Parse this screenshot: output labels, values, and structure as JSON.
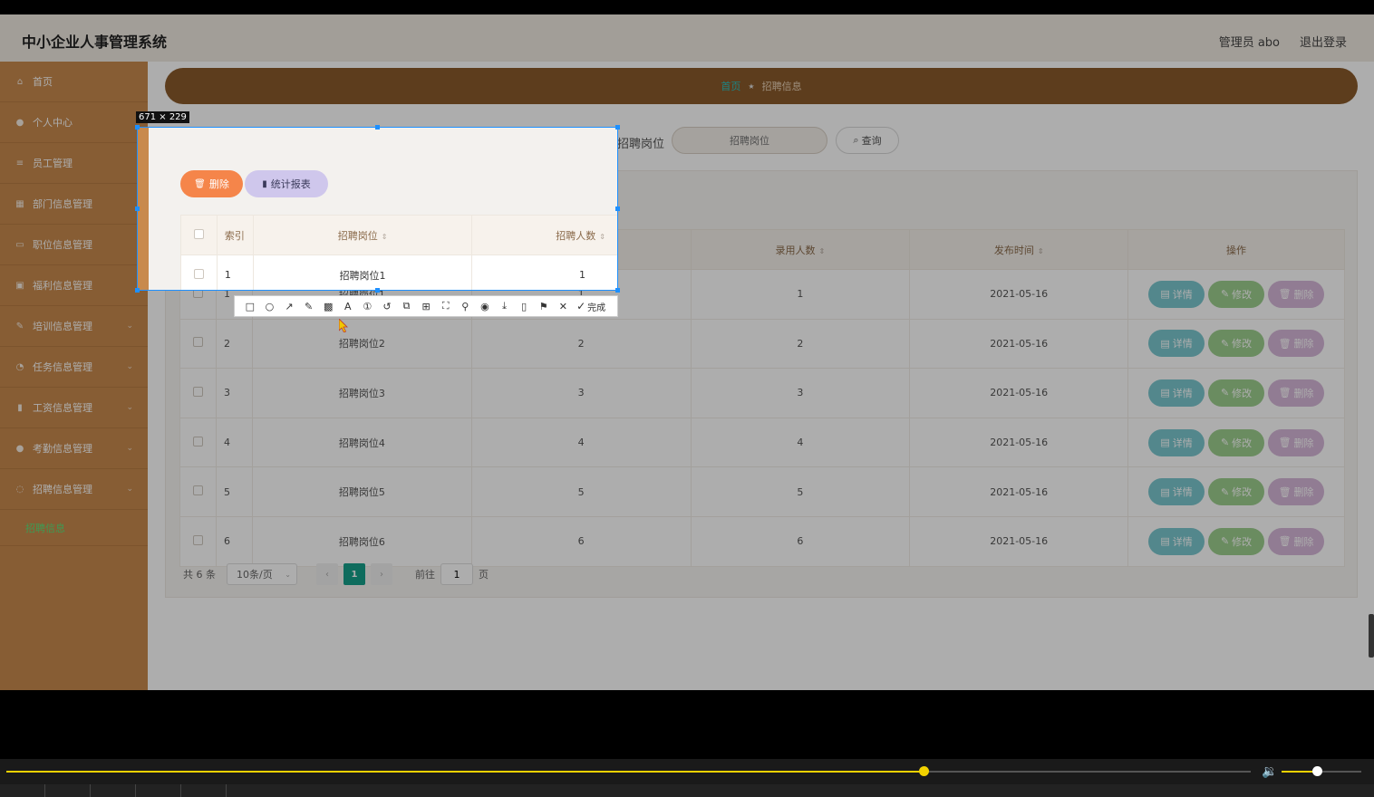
{
  "header": {
    "title": "中小企业人事管理系统",
    "admin": "管理员 abo",
    "logout": "退出登录"
  },
  "sidebar": {
    "items": [
      {
        "label": "首页",
        "icon": "home-icon",
        "glyph": "⌂"
      },
      {
        "label": "个人中心",
        "icon": "user-icon",
        "glyph": "●"
      },
      {
        "label": "员工管理",
        "icon": "list-icon",
        "glyph": "≡"
      },
      {
        "label": "部门信息管理",
        "icon": "building-icon",
        "glyph": "▦"
      },
      {
        "label": "职位信息管理",
        "icon": "briefcase-icon",
        "glyph": "▭"
      },
      {
        "label": "福利信息管理",
        "icon": "gift-icon",
        "glyph": "▣"
      },
      {
        "label": "培训信息管理",
        "icon": "edit-icon",
        "glyph": "✎"
      },
      {
        "label": "任务信息管理",
        "icon": "task-icon",
        "glyph": "◔"
      },
      {
        "label": "工资信息管理",
        "icon": "chart-icon",
        "glyph": "▮"
      },
      {
        "label": "考勤信息管理",
        "icon": "people-icon",
        "glyph": "●"
      },
      {
        "label": "招聘信息管理",
        "icon": "recruit-icon",
        "glyph": "◌"
      }
    ],
    "sub_item": "招聘信息"
  },
  "breadcrumb": {
    "home": "首页",
    "current": "招聘信息"
  },
  "search": {
    "label": "招聘岗位",
    "placeholder": "招聘岗位",
    "button": "查询",
    "button_icon": "search-icon"
  },
  "table": {
    "headers": [
      "索引",
      "招聘岗位",
      "招聘人数",
      "录用人数",
      "发布时间",
      "操作"
    ],
    "rows": [
      {
        "idx": "1",
        "post": "招聘岗位1",
        "need": "1",
        "hired": "1",
        "date": "2021-05-16"
      },
      {
        "idx": "2",
        "post": "招聘岗位2",
        "need": "2",
        "hired": "2",
        "date": "2021-05-16"
      },
      {
        "idx": "3",
        "post": "招聘岗位3",
        "need": "3",
        "hired": "3",
        "date": "2021-05-16"
      },
      {
        "idx": "4",
        "post": "招聘岗位4",
        "need": "4",
        "hired": "4",
        "date": "2021-05-16"
      },
      {
        "idx": "5",
        "post": "招聘岗位5",
        "need": "5",
        "hired": "5",
        "date": "2021-05-16"
      },
      {
        "idx": "6",
        "post": "招聘岗位6",
        "need": "6",
        "hired": "6",
        "date": "2021-05-16"
      }
    ],
    "actions": {
      "detail": "详情",
      "edit": "修改",
      "delete": "删除"
    }
  },
  "pager": {
    "total": "共 6 条",
    "page_size": "10条/页",
    "current_page": "1",
    "goto_prefix": "前往",
    "goto_value": "1",
    "goto_suffix": "页"
  },
  "capture": {
    "size_label": "671 × 229",
    "delete_button": "删除",
    "report_button": "统计报表"
  },
  "toolbar": {
    "tools": [
      {
        "name": "rectangle-tool-icon",
        "glyph": "□"
      },
      {
        "name": "ellipse-tool-icon",
        "glyph": "○"
      },
      {
        "name": "arrow-tool-icon",
        "glyph": "↗"
      },
      {
        "name": "pen-tool-icon",
        "glyph": "✎"
      },
      {
        "name": "mosaic-tool-icon",
        "glyph": "▩"
      },
      {
        "name": "text-tool-icon",
        "glyph": "A"
      },
      {
        "name": "number-tool-icon",
        "glyph": "①"
      },
      {
        "name": "undo-icon",
        "glyph": "↺"
      },
      {
        "name": "ocr-icon",
        "glyph": "⧉"
      },
      {
        "name": "translate-icon",
        "glyph": "⊞"
      },
      {
        "name": "scan-icon",
        "glyph": "⛶"
      },
      {
        "name": "pin-icon",
        "glyph": "⚲"
      },
      {
        "name": "record-icon",
        "glyph": "◉"
      },
      {
        "name": "download-icon",
        "glyph": "⤓"
      },
      {
        "name": "phone-icon",
        "glyph": "▯"
      },
      {
        "name": "bookmark-icon",
        "glyph": "⚑"
      },
      {
        "name": "close-icon",
        "glyph": "✕"
      }
    ],
    "done": "完成"
  },
  "player": {
    "progress": 0.737,
    "volume": 0.44
  },
  "colors": {
    "sidebar": "#c88a4d",
    "breadcrumb": "#8a5a2c",
    "accent": "#16a08a",
    "selection": "#1e90ff",
    "progress": "#f2d200"
  }
}
